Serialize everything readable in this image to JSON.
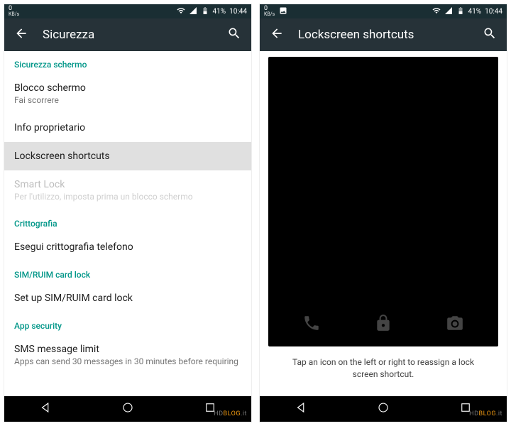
{
  "statusbar": {
    "speed_num": "0",
    "speed_unit": "KB/s",
    "battery": "41%",
    "time": "10:44"
  },
  "left": {
    "title": "Sicurezza",
    "sections": {
      "screen_security": "Sicurezza schermo",
      "screen_lock": {
        "label": "Blocco schermo",
        "sub": "Fai scorrere"
      },
      "owner_info": {
        "label": "Info proprietario"
      },
      "ls_shortcuts": {
        "label": "Lockscreen shortcuts"
      },
      "smart_lock": {
        "label": "Smart Lock",
        "sub": "Per l'utilizzo, imposta prima un blocco schermo"
      },
      "encryption": "Crittografia",
      "encrypt_phone": {
        "label": "Esegui crittografia telefono"
      },
      "sim_lock": "SIM/RUIM card lock",
      "sim_setup": {
        "label": "Set up SIM/RUIM card lock"
      },
      "app_security": "App security",
      "sms_limit": {
        "label": "SMS message limit",
        "sub": "Apps can send 30 messages in 30 minutes before requiring"
      }
    }
  },
  "right": {
    "title": "Lockscreen shortcuts",
    "hint": "Tap an icon on the left or right to reassign a lock screen shortcut."
  },
  "watermark": {
    "hd": "HD",
    "blog": "BLOG",
    "tld": ".it"
  }
}
